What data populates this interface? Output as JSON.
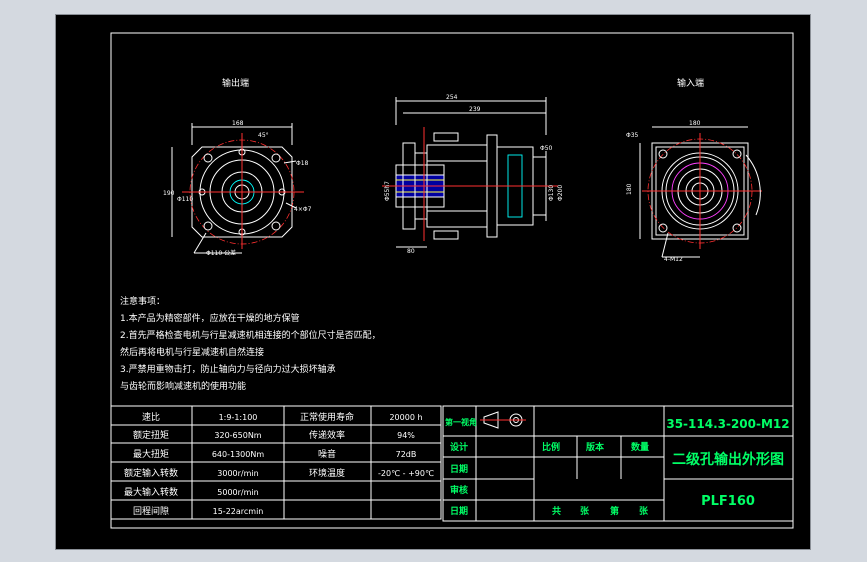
{
  "views": {
    "output_end_label": "输出端",
    "input_end_label": "输入端"
  },
  "dimensions": {
    "left_width": "168",
    "left_angle": "45°",
    "left_d1": "Φ18",
    "left_bolt": "4×Φ7",
    "left_height": "190",
    "left_d2": "Φ110",
    "left_tol": "Φ110 公差",
    "mid_total": "254",
    "mid_len": "239",
    "mid_d": "Φ55h7",
    "mid_short": "80",
    "mid_in1": "Φ50",
    "mid_in2": "Φ130",
    "mid_in3": "Φ200",
    "right_d": "Φ35",
    "right_w": "180",
    "right_h": "180",
    "right_tol": "4-M12"
  },
  "notes": {
    "title": "注意事项：",
    "lines": [
      "1.本产品为精密部件，应放在干燥的地方保管",
      "2.首先严格检查电机与行星减速机相连接的个部位尺寸是否匹配，",
      "然后再将电机与行星减速机自然连接",
      "3.严禁用重物击打，防止轴向力与径向力过大损坏轴承",
      "与齿轮而影响减速机的使用功能"
    ]
  },
  "specs": [
    {
      "label": "速比",
      "value": "1:9-1:100",
      "label2": "正常使用寿命",
      "value2": "20000 h"
    },
    {
      "label": "额定扭矩",
      "value": "320-650Nm",
      "label2": "传递效率",
      "value2": "94%"
    },
    {
      "label": "最大扭矩",
      "value": "640-1300Nm",
      "label2": "噪音",
      "value2": "72dB"
    },
    {
      "label": "额定输入转数",
      "value": "3000r/min",
      "label2": "环境温度",
      "value2": "-20℃ - +90℃"
    },
    {
      "label": "最大输入转数",
      "value": "5000r/min",
      "label2": "",
      "value2": ""
    },
    {
      "label": "回程间隙",
      "value": "15-22arcmin",
      "label2": "",
      "value2": ""
    }
  ],
  "title_block": {
    "projection": "第一视角",
    "design": "设计",
    "scale": "比例",
    "version": "版本",
    "quantity": "数量",
    "date": "日期",
    "review": "审核",
    "date2": "日期",
    "total_sheets": "共",
    "sheet_unit": "张",
    "sheet_no": "第",
    "sheet_unit2": "张",
    "drawing_no": "35-114.3-200-M12",
    "drawing_name": "二级孔输出外形图",
    "model": "PLF160"
  },
  "colors": {
    "paper": "#000000",
    "title_text": "#00ff66",
    "frame": "#ffffff",
    "centerline": "#ff3030"
  }
}
